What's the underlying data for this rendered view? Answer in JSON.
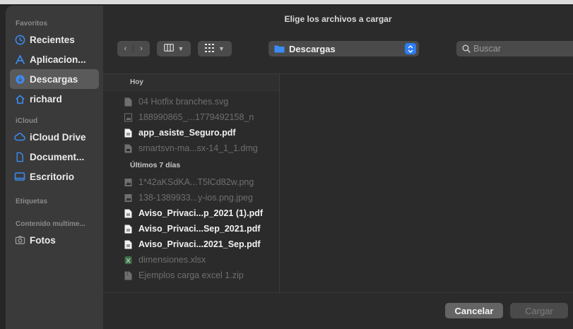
{
  "dialog": {
    "title": "Elige los archivos a cargar"
  },
  "sidebar": {
    "sections": [
      {
        "title": "Favoritos",
        "items": [
          {
            "label": "Recientes",
            "icon": "clock-icon",
            "selected": false
          },
          {
            "label": "Aplicacion...",
            "icon": "applications-icon",
            "selected": false
          },
          {
            "label": "Descargas",
            "icon": "downloads-icon",
            "selected": true
          },
          {
            "label": "richard",
            "icon": "home-icon",
            "selected": false
          }
        ]
      },
      {
        "title": "iCloud",
        "items": [
          {
            "label": "iCloud Drive",
            "icon": "cloud-icon",
            "selected": false
          },
          {
            "label": "Document...",
            "icon": "document-icon",
            "selected": false
          },
          {
            "label": "Escritorio",
            "icon": "desktop-icon",
            "selected": false
          }
        ]
      },
      {
        "title": "Etiquetas",
        "items": []
      },
      {
        "title": "Contenido multime...",
        "items": [
          {
            "label": "Fotos",
            "icon": "camera-icon",
            "selected": false
          }
        ]
      }
    ]
  },
  "toolbar": {
    "location": "Descargas",
    "search_placeholder": "Buscar"
  },
  "browser": {
    "header": "Hoy",
    "today": [
      {
        "name": "04 Hotfix branches.svg",
        "enabled": false
      },
      {
        "name": "188990865_...1779492158_n",
        "enabled": false
      },
      {
        "name": "app_asiste_Seguro.pdf",
        "enabled": true
      },
      {
        "name": "smartsvn-ma...sx-14_1_1.dmg",
        "enabled": false
      }
    ],
    "last7_title": "Últimos 7 días",
    "last7": [
      {
        "name": "1*42aKSdKA...T5lCd82w.png",
        "enabled": false
      },
      {
        "name": "138-1389933...y-ios.png.jpeg",
        "enabled": false
      },
      {
        "name": "Aviso_Privaci...p_2021 (1).pdf",
        "enabled": true
      },
      {
        "name": "Aviso_Privaci...Sep_2021.pdf",
        "enabled": true
      },
      {
        "name": "Aviso_Privaci...2021_Sep.pdf",
        "enabled": true
      },
      {
        "name": "dimensiones.xlsx",
        "enabled": false
      },
      {
        "name": "Ejemplos carga excel 1.zip",
        "enabled": false
      }
    ]
  },
  "footer": {
    "cancel_label": "Cancelar",
    "open_label": "Cargar"
  },
  "colors": {
    "accent": "#2d7df2",
    "sidebar_bg": "#3a3a3a",
    "selected_bg": "#5a5a5a"
  }
}
